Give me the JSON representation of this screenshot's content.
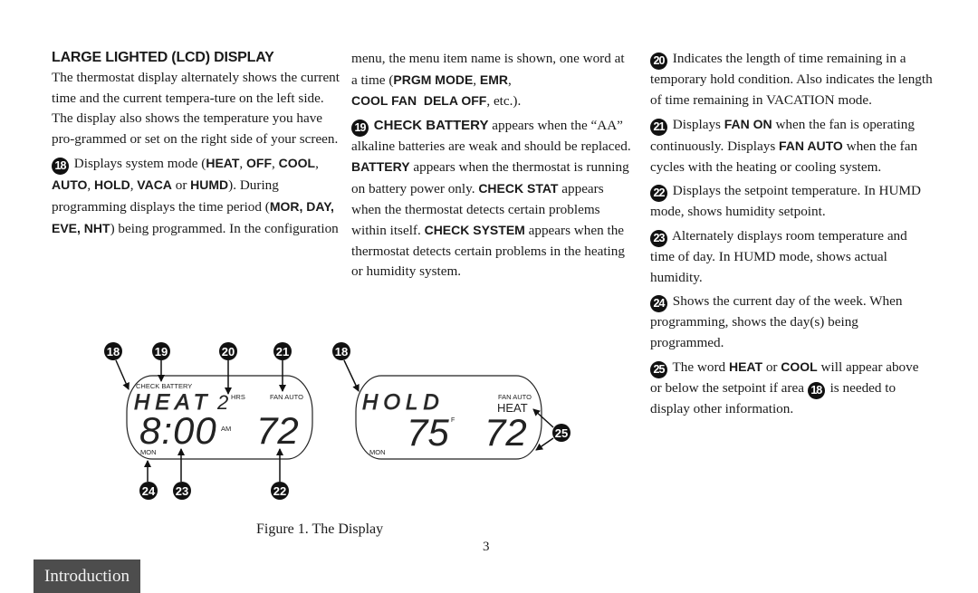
{
  "col1": {
    "heading": "LARGE LIGHTED (LCD) DISPLAY",
    "intro": "The thermostat display alternately shows the current time and the current tempera-ture on the left side. The display also shows the temperature you have pro-grammed or set on the right side of your screen.",
    "item18": {
      "num": "18",
      "t1": " Displays system mode (",
      "modes": [
        "HEAT",
        "OFF",
        "COOL",
        "AUTO",
        "HOLD",
        "VACA",
        "HUMD"
      ],
      "t2": "). During programming displays the time period (",
      "periods": "MOR, DAY, EVE, NHT",
      "t3": ") being programmed. In the configuration"
    }
  },
  "col2": {
    "cont1": "menu, the menu item name is shown, one word at a time (",
    "prgm": "PRGM MODE",
    "emr": "EMR",
    "coolfan": "COOL FAN  DELA OFF",
    "cont2": ", etc.).",
    "item19": {
      "num": "19",
      "check_battery": "CHECK BATTERY",
      "t1": " appears when the “AA” alkaline batteries are weak and should be replaced. ",
      "battery": "BATTERY",
      "t2": " appears when the thermostat is running on battery power only. ",
      "check_stat": "CHECK STAT",
      "t3": " appears when the thermostat detects certain problems within itself. ",
      "check_system": "CHECK SYSTEM",
      "t4": " appears when the thermostat detects certain problems in the heating or humidity system."
    }
  },
  "col3": {
    "item20": {
      "num": "20",
      "text": " Indicates the length of time remaining in a temporary hold condition. Also indicates the length of time remaining in VACATION mode."
    },
    "item21": {
      "num": "21",
      "t1": " Displays ",
      "fan_on": "FAN ON",
      "t2": " when the fan is operating continuously. Displays ",
      "fan_auto": "FAN AUTO",
      "t3": " when the fan cycles with the heating or cooling system."
    },
    "item22": {
      "num": "22",
      "text": " Displays the setpoint temperature. In HUMD mode, shows humidity setpoint."
    },
    "item23": {
      "num": "23",
      "text": " Alternately displays room temperature and time of day. In HUMD mode, shows actual humidity."
    },
    "item24": {
      "num": "24",
      "text": " Shows the current day of the week. When programming, shows the day(s) being programmed."
    },
    "item25": {
      "num": "25",
      "t1": " The word ",
      "heat": "HEAT",
      "t2": " or ",
      "cool": "COOL",
      "t3": " will appear above or below the setpoint if area ",
      "ref": "18",
      "t4": " is needed to display other information."
    }
  },
  "figure": {
    "caption": "Figure 1. The Display",
    "callouts_left": [
      "18",
      "19",
      "20",
      "21",
      "24",
      "23",
      "22"
    ],
    "callouts_right": [
      "18",
      "25"
    ],
    "lcd_left": {
      "check_battery": "CHECK BATTERY",
      "mode": "HEAT",
      "hold_hours": "2",
      "hrs": "HRS",
      "fan": "FAN AUTO",
      "time": "8:00",
      "ampm": "AM",
      "setpoint": "72",
      "day": "MON"
    },
    "lcd_right": {
      "mode": "HOLD",
      "fan": "FAN AUTO",
      "heat": "HEAT",
      "room_temp": "75",
      "unit": "F",
      "setpoint": "72",
      "day": "MON"
    }
  },
  "footer": {
    "page_number": "3",
    "section_tab": "Introduction"
  }
}
